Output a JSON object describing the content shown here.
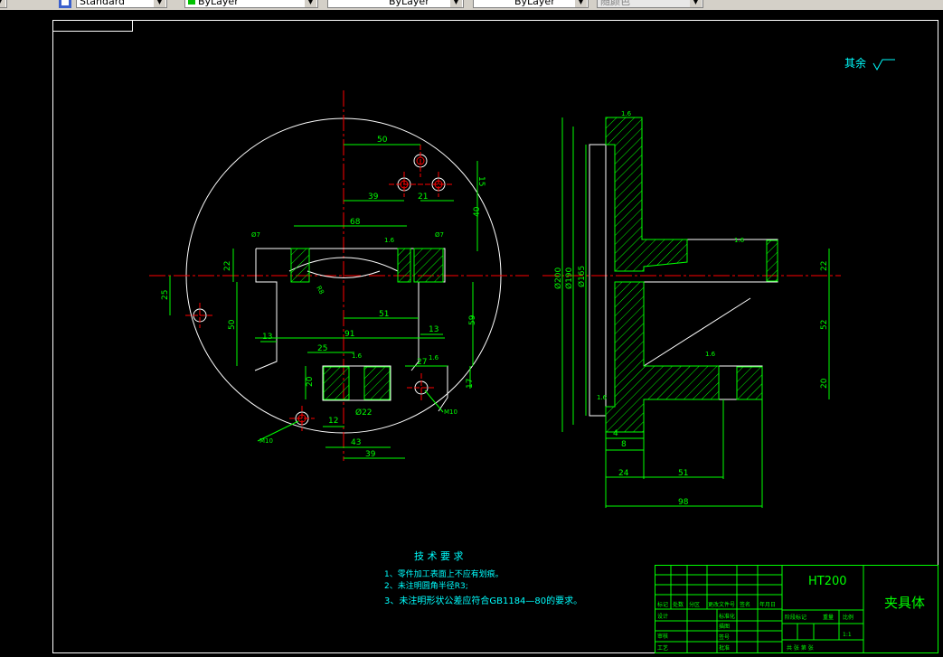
{
  "toolbar": {
    "text_style": "Standard",
    "layer": "ByLayer",
    "linetype": "ByLayer",
    "lineweight": "ByLayer",
    "plot_style": "随颜色"
  },
  "drawing": {
    "surface_note": "其余",
    "tech_req_title": "技 术 要 求",
    "tech_req_1": "1、零件加工表面上不应有划痕。",
    "tech_req_2": "2、未注明圆角半径R3;",
    "tech_req_3": "3、未注明形状公差应符合GB1184—80的要求。",
    "material": "HT200",
    "part_name": "夹具体",
    "scale": "1:1",
    "title_labels": {
      "mark": "标记",
      "count": "处数",
      "zone": "分区",
      "change_doc": "更改文件号",
      "sign": "签名",
      "date": "年月日",
      "design": "设计",
      "standardize": "标准化",
      "check": "审核",
      "process": "工艺",
      "approve": "批准",
      "drawn": "描图",
      "serial": "签号",
      "stage_mark": "阶段标记",
      "weight": "重量",
      "ratio": "比例",
      "total": "共  张  第  张"
    },
    "dims_left": {
      "d50": "50",
      "d39": "39",
      "d21": "21",
      "d15": "15",
      "d40": "40",
      "d68": "68",
      "d22": "22",
      "d25": "25",
      "d50b": "50",
      "d51": "51",
      "d13a": "13",
      "d13b": "13",
      "d91": "91",
      "d59": "59",
      "d25b": "25",
      "d27": "27",
      "d20": "20",
      "d17": "17",
      "d12": "12",
      "d43": "43",
      "d39b": "39",
      "phi22": "Ø22",
      "m10a": "M10",
      "m10b": "M10",
      "phi7a": "Ø7",
      "phi7b": "Ø7",
      "r": "R8",
      "rough16a": "1.6",
      "rough16b": "1.6",
      "rough16c": "1.6"
    },
    "dims_right": {
      "phi200": "Ø200",
      "phi190": "Ø190",
      "phi165": "Ø165",
      "d22": "22",
      "d52": "52",
      "d20": "20",
      "d8": "8",
      "d4": "4",
      "d24": "24",
      "d51": "51",
      "d98": "98",
      "rough16a": "1.6",
      "rough16b": "1.6",
      "rough16c": "1.6",
      "rough16d": "1.6"
    }
  },
  "colors": {
    "outline": "#ffffff",
    "center": "#ff0000",
    "dimension": "#00ff00",
    "hatch": "#00ff00",
    "text": "#00ffff",
    "title_block": "#00ff00"
  }
}
